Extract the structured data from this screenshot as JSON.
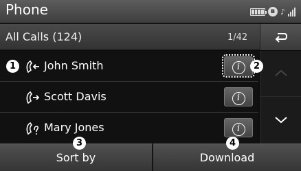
{
  "header": {
    "title": "Phone",
    "status_icons": [
      "battery-icon",
      "bluetooth-phone-icon",
      "signal-strength-icon"
    ]
  },
  "subheader": {
    "title": "All Calls (124)",
    "page": "1/42",
    "back_icon": "back-arrow-icon"
  },
  "calls": [
    {
      "name": "John Smith",
      "type": "incoming",
      "icon": "incoming-call-icon",
      "info_focused": true
    },
    {
      "name": "Scott Davis",
      "type": "outgoing",
      "icon": "outgoing-call-icon",
      "info_focused": false
    },
    {
      "name": "Mary Jones",
      "type": "missed",
      "icon": "missed-call-icon",
      "info_focused": false
    }
  ],
  "scroll": {
    "up_icon": "chevron-up-icon",
    "down_icon": "chevron-down-icon"
  },
  "bottom": {
    "sort_label": "Sort by",
    "download_label": "Download"
  },
  "markers": [
    "1",
    "2",
    "3",
    "4"
  ],
  "info_glyph": "i",
  "colors": {
    "background": "#0d0d0d",
    "bar": "#4a4a4a",
    "text": "#f2f2f2"
  }
}
